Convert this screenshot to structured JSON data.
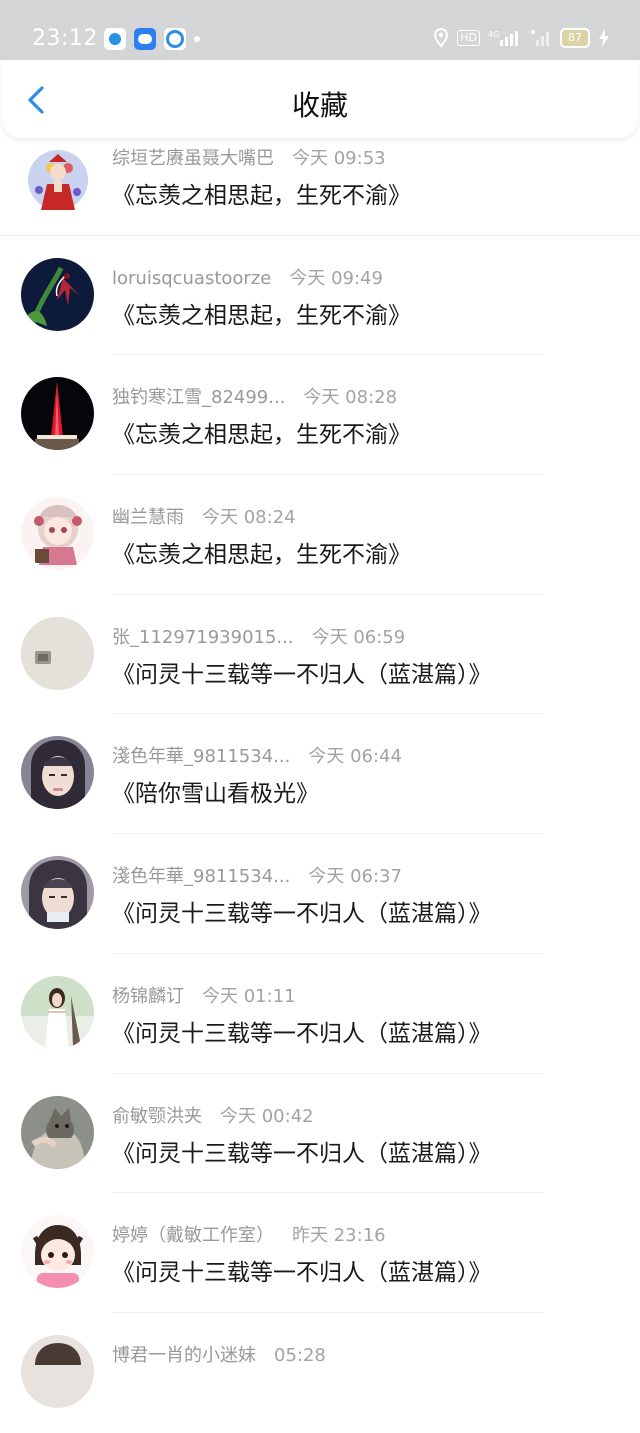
{
  "status_bar": {
    "time": "23:12",
    "battery": "87",
    "hd_badge": "HD",
    "network": "4G"
  },
  "nav": {
    "title": "收藏",
    "back_icon": "chevron-left-icon"
  },
  "colors": {
    "accent": "#2a8fe6",
    "status_bar_bg": "#d4d5d7",
    "meta_text": "#999999",
    "title_text": "#1a1a1a"
  },
  "favorites": [
    {
      "name": "综垣艺赓虽聂大嘴巴",
      "time": "今天 09:53",
      "title": "《忘羡之相思起，生死不渝》"
    },
    {
      "name": "loruisqcuastoorze",
      "time": "今天 09:49",
      "title": "《忘羡之相思起，生死不渝》"
    },
    {
      "name": "独钓寒江雪_82499...",
      "time": "今天 08:28",
      "title": "《忘羡之相思起，生死不渝》"
    },
    {
      "name": "幽兰慧雨",
      "time": "今天 08:24",
      "title": "《忘羡之相思起，生死不渝》"
    },
    {
      "name": "张_112971939015...",
      "time": "今天 06:59",
      "title": "《问灵十三载等一不归人（蓝湛篇）》"
    },
    {
      "name": "淺色年華_9811534...",
      "time": "今天 06:44",
      "title": "《陪你雪山看极光》"
    },
    {
      "name": "淺色年華_9811534...",
      "time": "今天 06:37",
      "title": "《问灵十三载等一不归人（蓝湛篇）》"
    },
    {
      "name": "杨锦麟订",
      "time": "今天 01:11",
      "title": "《问灵十三载等一不归人（蓝湛篇）》"
    },
    {
      "name": "俞敏颚洪夹",
      "time": "今天 00:42",
      "title": "《问灵十三载等一不归人（蓝湛篇）》"
    },
    {
      "name": "婷婷（戴敏工作室）",
      "time": "昨天 23:16",
      "title": "《问灵十三载等一不归人（蓝湛篇）》"
    },
    {
      "name": "博君一肖的小迷妹",
      "time": "05:28",
      "title": ""
    }
  ]
}
